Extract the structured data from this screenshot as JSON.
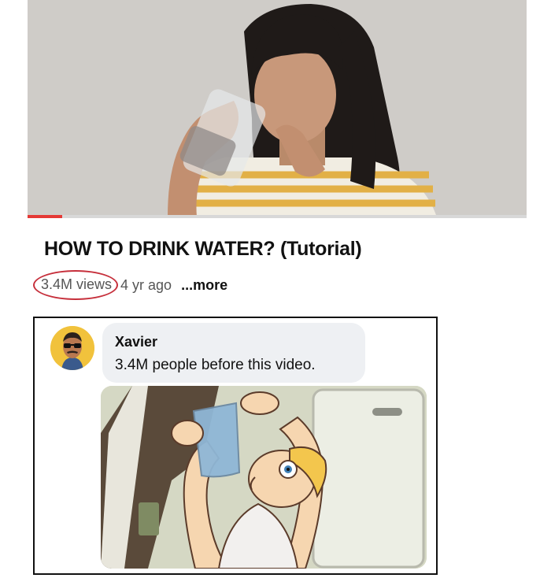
{
  "video": {
    "title": "HOW TO DRINK WATER? (Tutorial)",
    "views": "3.4M views",
    "age": "4 yr ago",
    "more_label": "...more",
    "progress_fraction": 0.07,
    "accent_color": "#e53935"
  },
  "comment": {
    "author": "Xavier",
    "text": "3.4M people before this video.",
    "avatar_icon": "profile-avatar-sunglasses",
    "image_icon": "cartoon-drinking-water"
  }
}
